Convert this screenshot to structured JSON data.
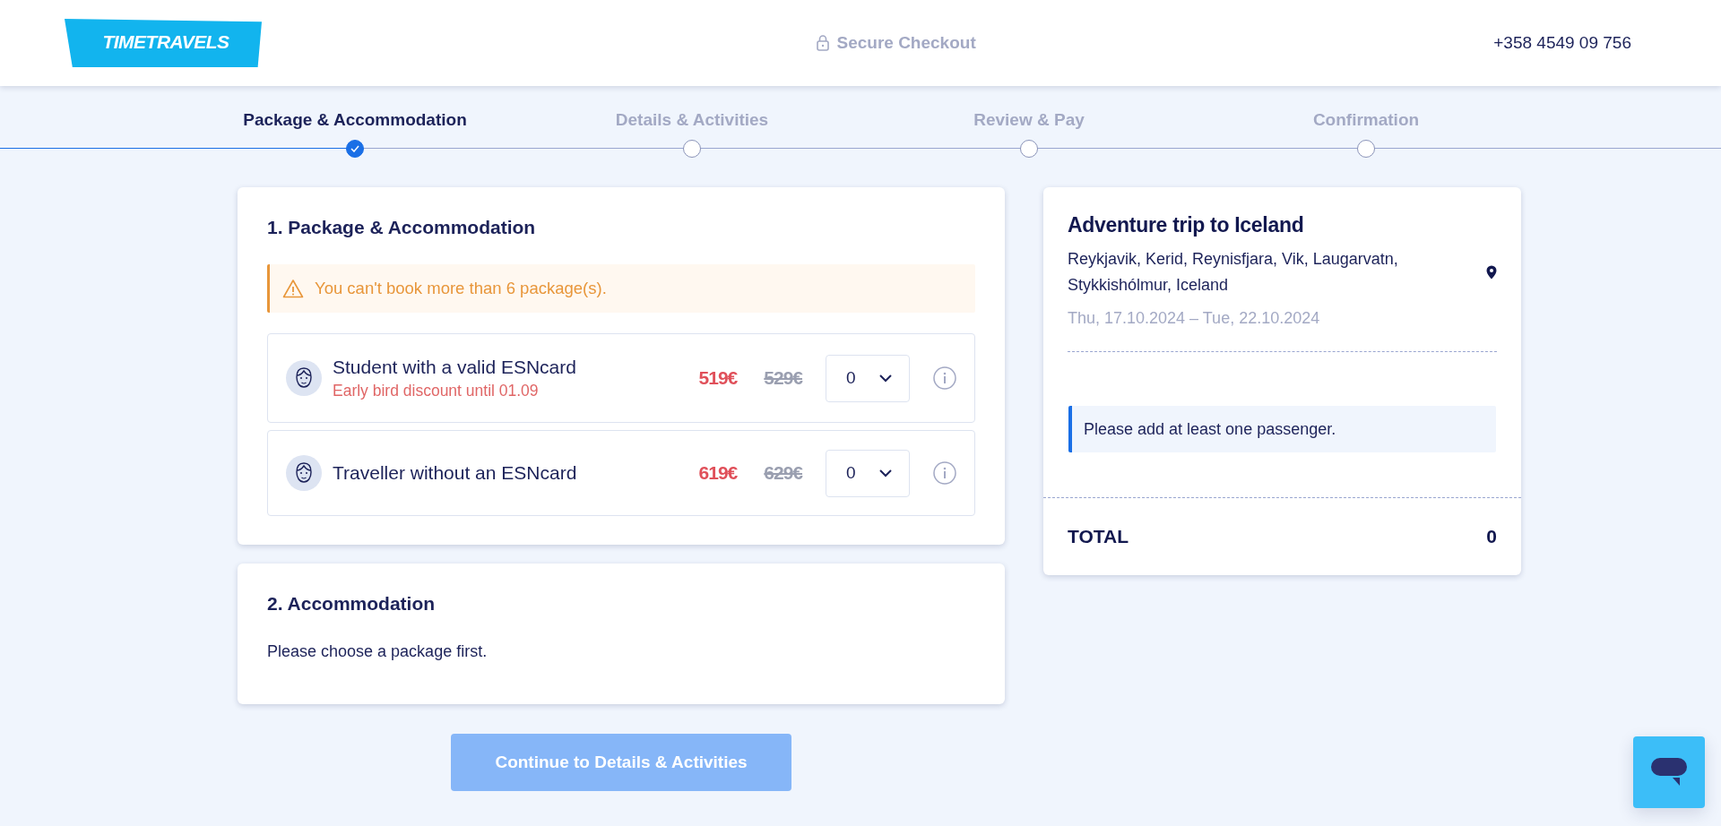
{
  "header": {
    "logo": "TIMETRAVELS",
    "secure_label": "Secure Checkout",
    "phone": "+358 4549 09 756"
  },
  "steps": [
    {
      "label": "Package & Accommodation",
      "selected": true,
      "completed": true
    },
    {
      "label": "Details & Activities",
      "selected": false,
      "completed": false
    },
    {
      "label": "Review & Pay",
      "selected": false,
      "completed": false
    },
    {
      "label": "Confirmation",
      "selected": false,
      "completed": false
    }
  ],
  "package_section": {
    "title": "1. Package & Accommodation",
    "warning": "You can't book more than 6 package(s).",
    "packages": [
      {
        "name": "Student with a valid ESNcard",
        "note": "Early bird discount until 01.09",
        "price": "519€",
        "old_price": "529€",
        "quantity": "0"
      },
      {
        "name": "Traveller without an ESNcard",
        "price": "619€",
        "old_price": "629€",
        "quantity": "0"
      }
    ]
  },
  "accommodation_section": {
    "title": "2. Accommodation",
    "message": "Please choose a package first."
  },
  "continue_button": {
    "label": "Continue to Details & Activities",
    "disabled": true
  },
  "summary": {
    "title": "Adventure trip to Iceland",
    "locations": "Reykjavik, Kerid, Reynisfjara, Vik, Laugarvatn, Stykkishólmur, Iceland",
    "dates": "Thu, 17.10.2024 – Tue, 22.10.2024",
    "notice": "Please add at least one passenger.",
    "total_label": "TOTAL",
    "total_value": "0"
  }
}
